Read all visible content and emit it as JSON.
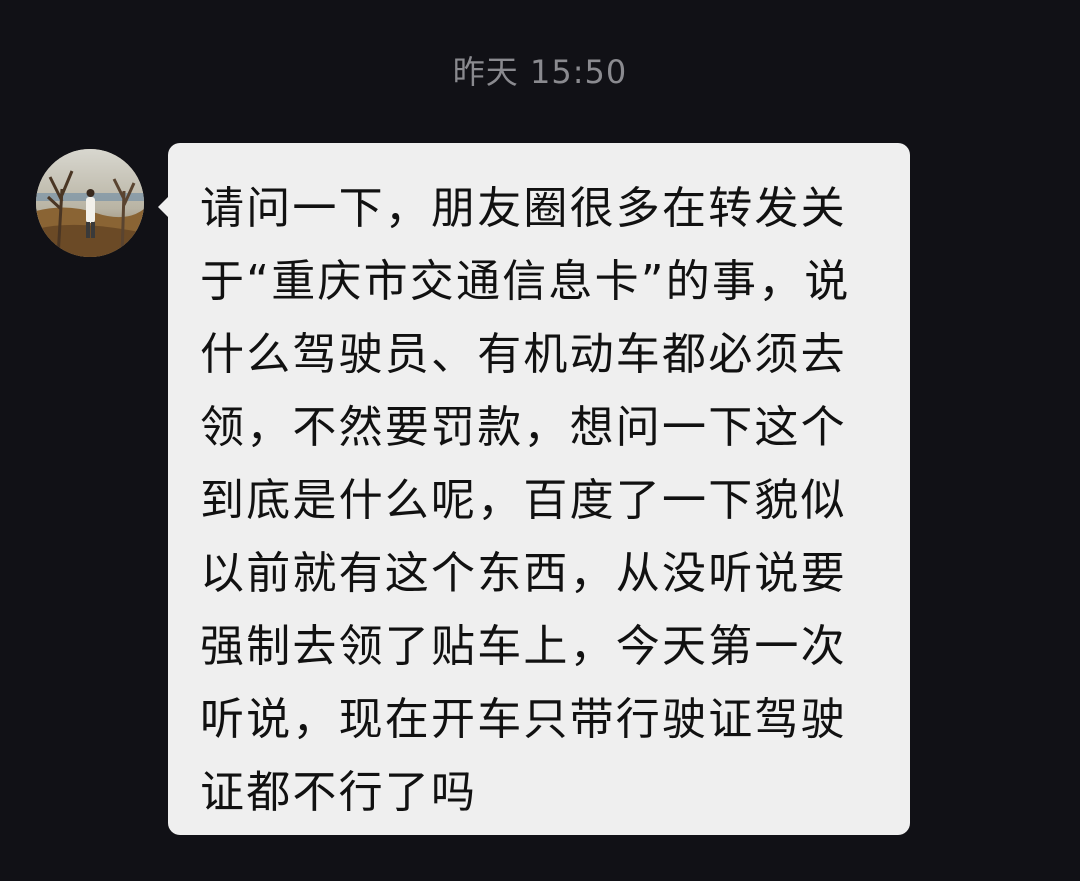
{
  "chat": {
    "timestamp": "昨天 15:50",
    "message": {
      "lines": [
        "请问一下，朋友圈很多在转发关",
        "于“重庆市交通信息卡”的事，说",
        "什么驾驶员、有机动车都必须去",
        "领，不然要罚款，想问一下这个",
        "到底是什么呢，百度了一下貌似",
        "以前就有这个东西，从没听说要",
        "强制去领了贴车上，今天第一次",
        "听说，现在开车只带行驶证驾驶",
        "证都不行了吗"
      ]
    }
  },
  "colors": {
    "background": "#111116",
    "bubble": "#efefef",
    "timestamp_text": "#8a8a8f",
    "message_text": "#111111"
  }
}
